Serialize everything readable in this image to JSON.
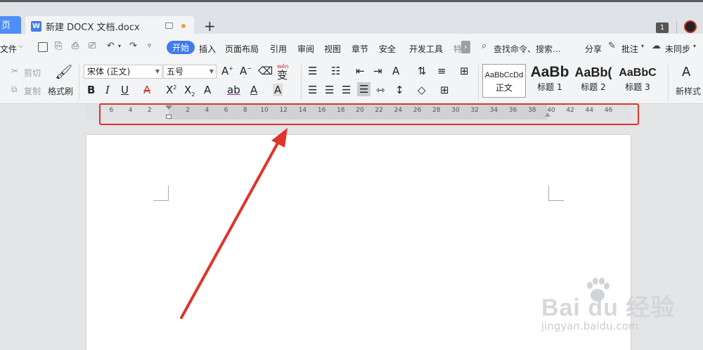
{
  "tabs": {
    "home_label": "页",
    "document_title": "新建 DOCX 文档.docx",
    "word_icon": "W",
    "new_tab_label": "+",
    "page_count": "1"
  },
  "menu": {
    "file": "文件",
    "items": [
      "开始",
      "插入",
      "页面布局",
      "引用",
      "审阅",
      "视图",
      "章节",
      "安全",
      "开发工具"
    ],
    "search_placeholder": "查找命令、搜索...",
    "share": "分享",
    "comment": "批注",
    "sync": "未同步"
  },
  "ribbon": {
    "cut": "剪切",
    "copy": "复制",
    "format_painter": "格式刷",
    "font_name": "宋体 (正文)",
    "font_size": "五号",
    "phonetic": "wén",
    "styles": [
      {
        "sample": "AaBbCcDd",
        "name": "正文"
      },
      {
        "sample": "AaBb",
        "name": "标题 1"
      },
      {
        "sample": "AaBb(",
        "name": "标题 2"
      },
      {
        "sample": "AaBbC",
        "name": "标题 3"
      }
    ],
    "new_style": "新样式"
  },
  "ruler": {
    "ticks": [
      "6",
      "4",
      "2",
      "2",
      "4",
      "6",
      "8",
      "10",
      "12",
      "14",
      "16",
      "18",
      "20",
      "22",
      "24",
      "26",
      "28",
      "30",
      "32",
      "34",
      "36",
      "38",
      "40",
      "42",
      "44",
      "46"
    ]
  },
  "watermark": {
    "brand": "Bai du 经验",
    "url": "jingyan.baidu.com"
  },
  "colors": {
    "accent": "#3f7ce8",
    "annotation_red": "#e0342a"
  }
}
